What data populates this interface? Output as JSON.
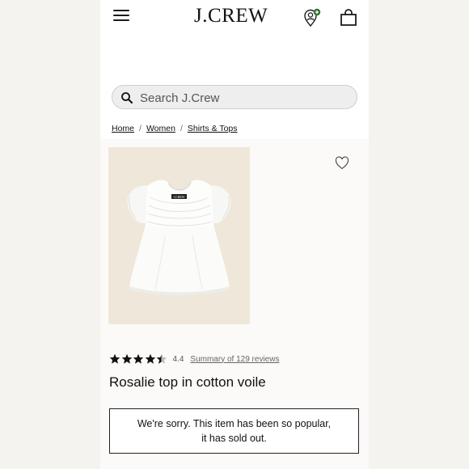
{
  "header": {
    "logo_text": "J.CREW",
    "menu_icon": "hamburger-menu-icon",
    "account_icon": "account-pin-icon",
    "bag_icon": "shopping-bag-icon"
  },
  "search": {
    "placeholder": "Search J.Crew",
    "icon": "search-icon"
  },
  "breadcrumb": {
    "items": [
      "Home",
      "Women",
      "Shirts & Tops"
    ],
    "separator": "/"
  },
  "product": {
    "image_label": "J.CREW",
    "name": "Rosalie top in cotton voile",
    "rating": {
      "score": "4.4",
      "stars": 4.4,
      "reviews_link": "Summary of 129 reviews"
    },
    "favorite_icon": "heart-outline-icon"
  },
  "availability": {
    "line1": "We're sorry. This item has been so popular,",
    "line2": "it has sold out."
  },
  "colors": {
    "image_bg": "#efe7d9",
    "account_badge": "#2e6b2e",
    "search_bg": "#eeeeee"
  }
}
